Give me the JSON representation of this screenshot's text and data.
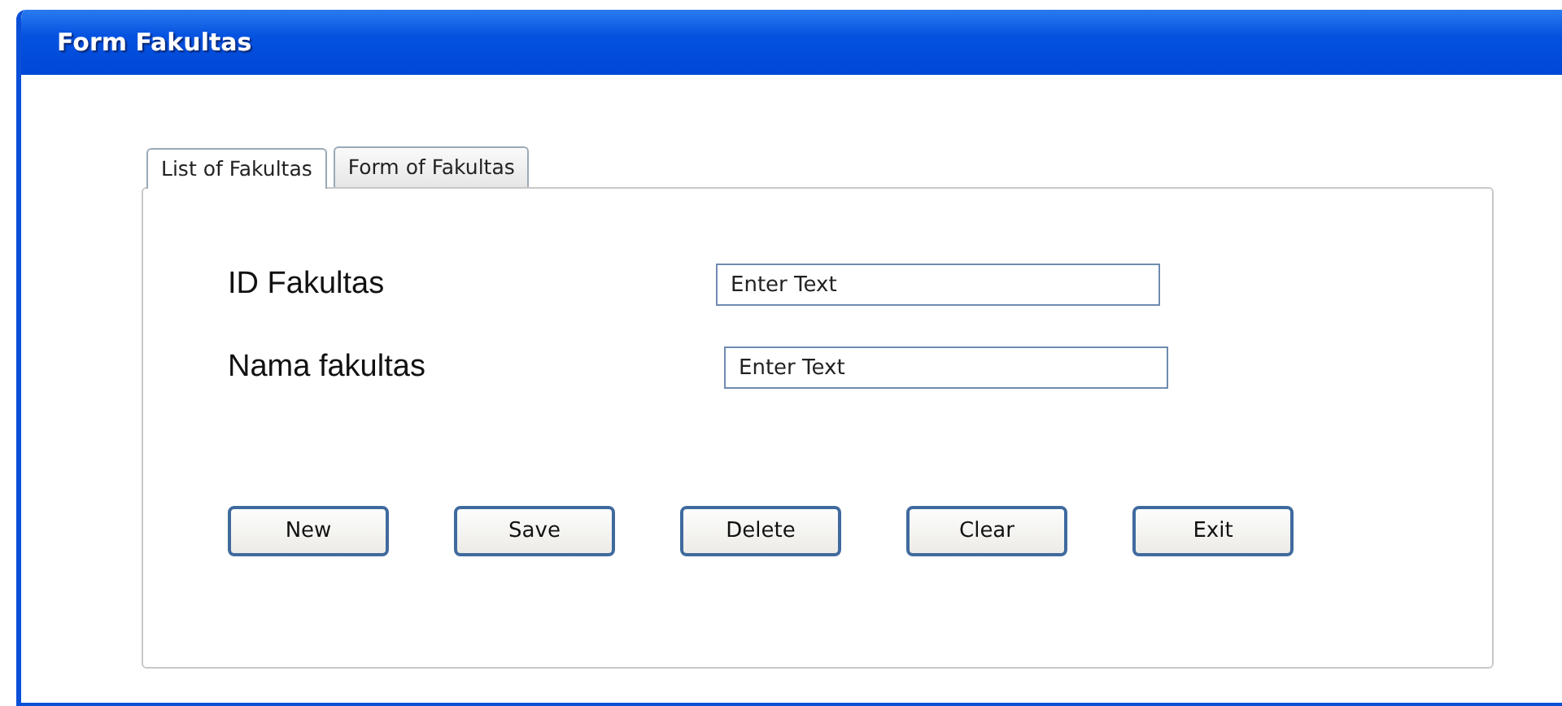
{
  "window": {
    "title": "Form Fakultas"
  },
  "tabs": [
    {
      "label": "List of Fakultas",
      "selected": true
    },
    {
      "label": "Form of Fakultas",
      "selected": false
    }
  ],
  "fields": [
    {
      "label": "ID Fakultas",
      "placeholder": "Enter Text"
    },
    {
      "label": "Nama fakultas",
      "placeholder": "Enter Text"
    }
  ],
  "buttons": [
    "New",
    "Save",
    "Delete",
    "Clear",
    "Exit"
  ]
}
